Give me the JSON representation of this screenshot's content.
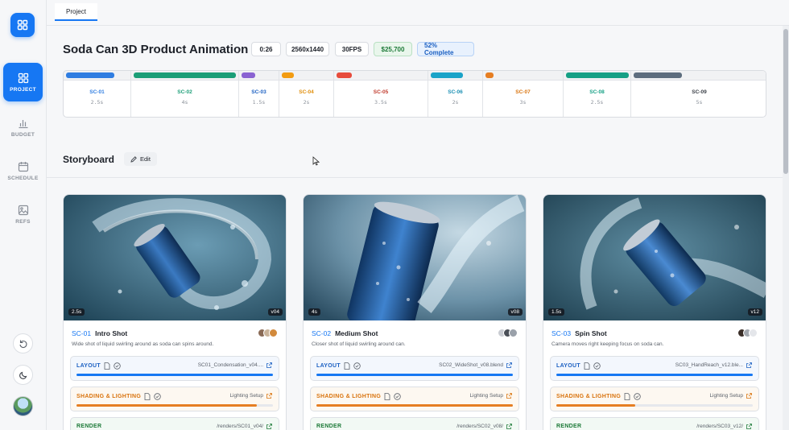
{
  "nav": {
    "items": [
      {
        "label": "PROJECT",
        "icon": "grid-icon",
        "active": true
      },
      {
        "label": "BUDGET",
        "icon": "bar-chart-icon",
        "active": false
      },
      {
        "label": "SCHEDULE",
        "icon": "calendar-icon",
        "active": false
      },
      {
        "label": "REFS",
        "icon": "image-icon",
        "active": false
      }
    ]
  },
  "tabs": {
    "project": "Project"
  },
  "project": {
    "title": "Soda Can 3D Product Animation",
    "duration": "0:26",
    "resolution": "2560x1440",
    "fps": "30FPS",
    "budget": "$25,700",
    "progress": "52% Complete"
  },
  "timeline": [
    {
      "id": "SC-01",
      "dur": "2.5s",
      "color": "#2f7de1"
    },
    {
      "id": "SC-02",
      "dur": "4s",
      "color": "#1b9e77"
    },
    {
      "id": "SC-03",
      "dur": "1.5s",
      "color": "#8a63d2"
    },
    {
      "id": "SC-04",
      "dur": "2s",
      "color": "#f39c12"
    },
    {
      "id": "SC-05",
      "dur": "3.5s",
      "color": "#e74c3c"
    },
    {
      "id": "SC-06",
      "dur": "2s",
      "color": "#1aa3c8"
    },
    {
      "id": "SC-07",
      "dur": "3s",
      "color": "#e67e22"
    },
    {
      "id": "SC-08",
      "dur": "2.5s",
      "color": "#16a085"
    },
    {
      "id": "SC-09",
      "dur": "5s",
      "color": "#5d6d7e"
    }
  ],
  "storyboard": {
    "title": "Storyboard",
    "edit": "Edit"
  },
  "cards": [
    {
      "id": "SC-01",
      "name": "Intro Shot",
      "desc": "Wide shot of liquid swirling around as soda can spins around.",
      "dur": "2.5s",
      "version": "v04",
      "layout": {
        "label": "LAYOUT",
        "file": "SC01_Condensation_v04....",
        "progress": 1.0
      },
      "shading": {
        "label": "SHADING & LIGHTING",
        "file": "Lighting Setup",
        "progress": 0.92
      },
      "render": {
        "label": "RENDER",
        "file": "/renders/SC01_v04/"
      }
    },
    {
      "id": "SC-02",
      "name": "Medium Shot",
      "desc": "Closer shot of liquid swirling around can.",
      "dur": "4s",
      "version": "v08",
      "layout": {
        "label": "LAYOUT",
        "file": "SC02_WideShot_v08.blend",
        "progress": 1.0
      },
      "shading": {
        "label": "SHADING & LIGHTING",
        "file": "Lighting Setup",
        "progress": 1.0
      },
      "render": {
        "label": "RENDER",
        "file": "/renders/SC02_v08/"
      }
    },
    {
      "id": "SC-03",
      "name": "Spin Shot",
      "desc": "Camera moves right keeping focus on soda can.",
      "dur": "1.5s",
      "version": "v12",
      "layout": {
        "label": "LAYOUT",
        "file": "SC03_HandReach_v12.ble...",
        "progress": 1.0
      },
      "shading": {
        "label": "SHADING & LIGHTING",
        "file": "Lighting Setup",
        "progress": 0.4
      },
      "render": {
        "label": "RENDER",
        "file": "/renders/SC03_v12/"
      }
    }
  ],
  "colors": {
    "accent": "#1677f3",
    "layout": "#1a5fc2",
    "shading": "#d9730d",
    "render": "#1d7a38"
  }
}
